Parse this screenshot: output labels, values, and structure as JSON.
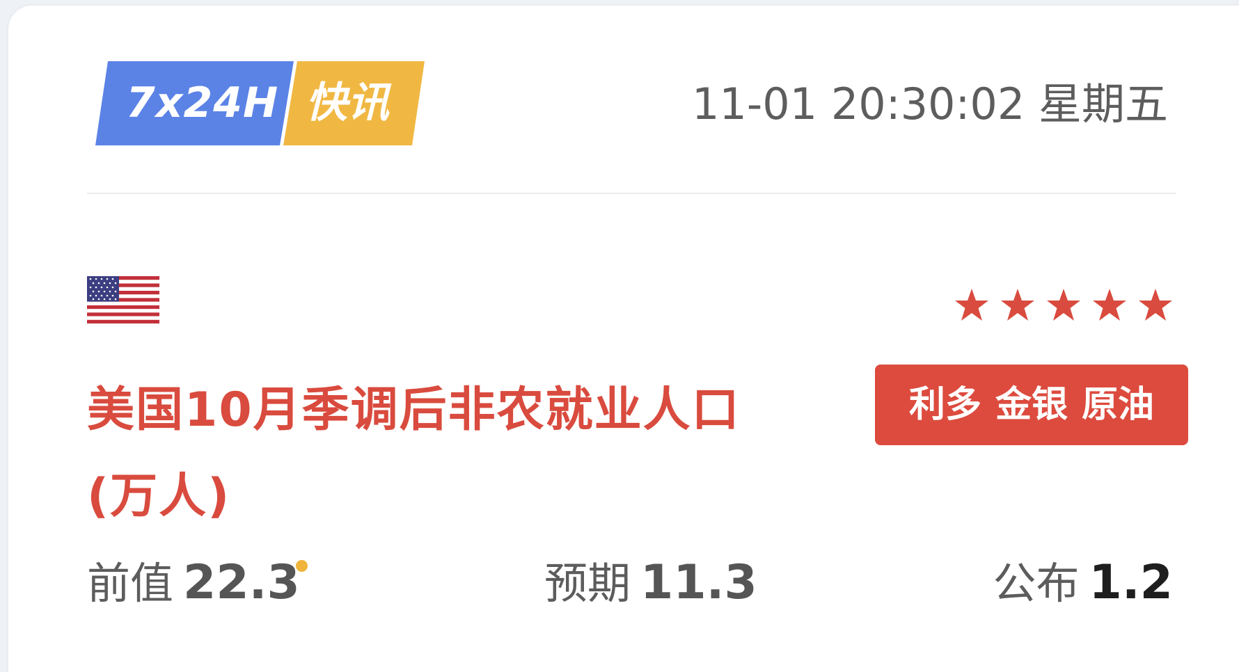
{
  "header": {
    "badge_left": "7x24H",
    "badge_right": "快讯",
    "badge_left_color": "#5b83e6",
    "badge_right_color": "#f0b843",
    "timestamp": "11-01 20:30:02 星期五"
  },
  "item": {
    "flag_icon": "us-flag-icon",
    "importance_stars": 5,
    "importance_max": 5,
    "title": "美国10月季调后非农就业人口(万人)",
    "title_color": "#d94b3e",
    "tag": {
      "impact": "利多",
      "assets": [
        "金银",
        "原油"
      ],
      "color": "#dc4b3e"
    },
    "stats": {
      "previous_label": "前值",
      "previous_value": "22.3",
      "previous_revised_dot_color": "#f0b43a",
      "expected_label": "预期",
      "expected_value": "11.3",
      "published_label": "公布",
      "published_value": "1.2"
    }
  }
}
